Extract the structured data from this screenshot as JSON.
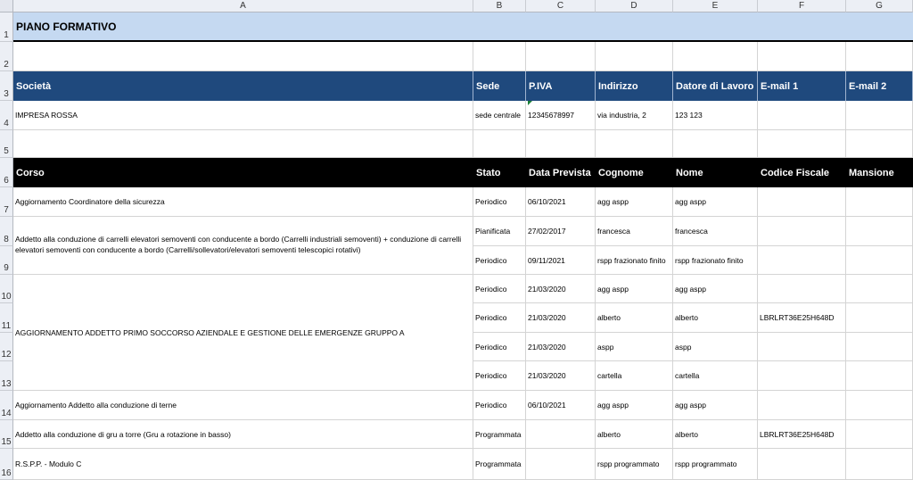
{
  "columns": [
    "A",
    "B",
    "C",
    "D",
    "E",
    "F",
    "G"
  ],
  "rows": [
    "1",
    "2",
    "3",
    "4",
    "5",
    "6",
    "7",
    "8",
    "9",
    "10",
    "11",
    "12",
    "13",
    "14",
    "15",
    "16"
  ],
  "title": "PIANO FORMATIVO",
  "company_header": [
    "Società",
    "Sede",
    "P.IVA",
    "Indirizzo",
    "Datore di Lavoro",
    "E-mail 1",
    "E-mail 2"
  ],
  "company_row": [
    "IMPRESA ROSSA",
    "sede centrale",
    "12345678997",
    "via industria, 2",
    "123 123",
    "",
    ""
  ],
  "course_header": [
    "Corso",
    "Stato",
    "Data Prevista",
    "Cognome",
    "Nome",
    "Codice Fiscale",
    "Mansione"
  ],
  "courses": {
    "c7": "Aggiornamento Coordinatore della sicurezza",
    "c8": "Addetto alla conduzione di carrelli elevatori semoventi con conducente a bordo (Carrelli industriali semoventi) + conduzione di carrelli elevatori semoventi con conducente a bordo (Carrelli/sollevatori/elevatori semoventi telescopici rotativi)",
    "c10": "AGGIORNAMENTO ADDETTO PRIMO SOCCORSO AZIENDALE E GESTIONE DELLE EMERGENZE GRUPPO A",
    "c14": "Aggiornamento Addetto alla conduzione di terne",
    "c15": "Addetto alla conduzione di gru a torre (Gru a rotazione in basso)",
    "c16": "R.S.P.P. - Modulo C"
  },
  "detail_rows": [
    [
      "Periodico",
      "06/10/2021",
      "agg aspp",
      "agg aspp",
      "",
      ""
    ],
    [
      "Pianificata",
      "27/02/2017",
      "francesca",
      "francesca",
      "",
      ""
    ],
    [
      "Periodico",
      "09/11/2021",
      "rspp frazionato finito",
      "rspp frazionato finito",
      "",
      ""
    ],
    [
      "Periodico",
      "21/03/2020",
      "agg aspp",
      "agg aspp",
      "",
      ""
    ],
    [
      "Periodico",
      "21/03/2020",
      "alberto",
      "alberto",
      "LBRLRT36E25H648D",
      ""
    ],
    [
      "Periodico",
      "21/03/2020",
      "aspp",
      "aspp",
      "",
      ""
    ],
    [
      "Periodico",
      "21/03/2020",
      "cartella",
      "cartella",
      "",
      ""
    ],
    [
      "Periodico",
      "06/10/2021",
      "agg aspp",
      "agg aspp",
      "",
      ""
    ],
    [
      "Programmata",
      "",
      "alberto",
      "alberto",
      "LBRLRT36E25H648D",
      ""
    ],
    [
      "Programmata",
      "",
      "rspp programmato",
      "rspp programmato",
      "",
      ""
    ]
  ]
}
